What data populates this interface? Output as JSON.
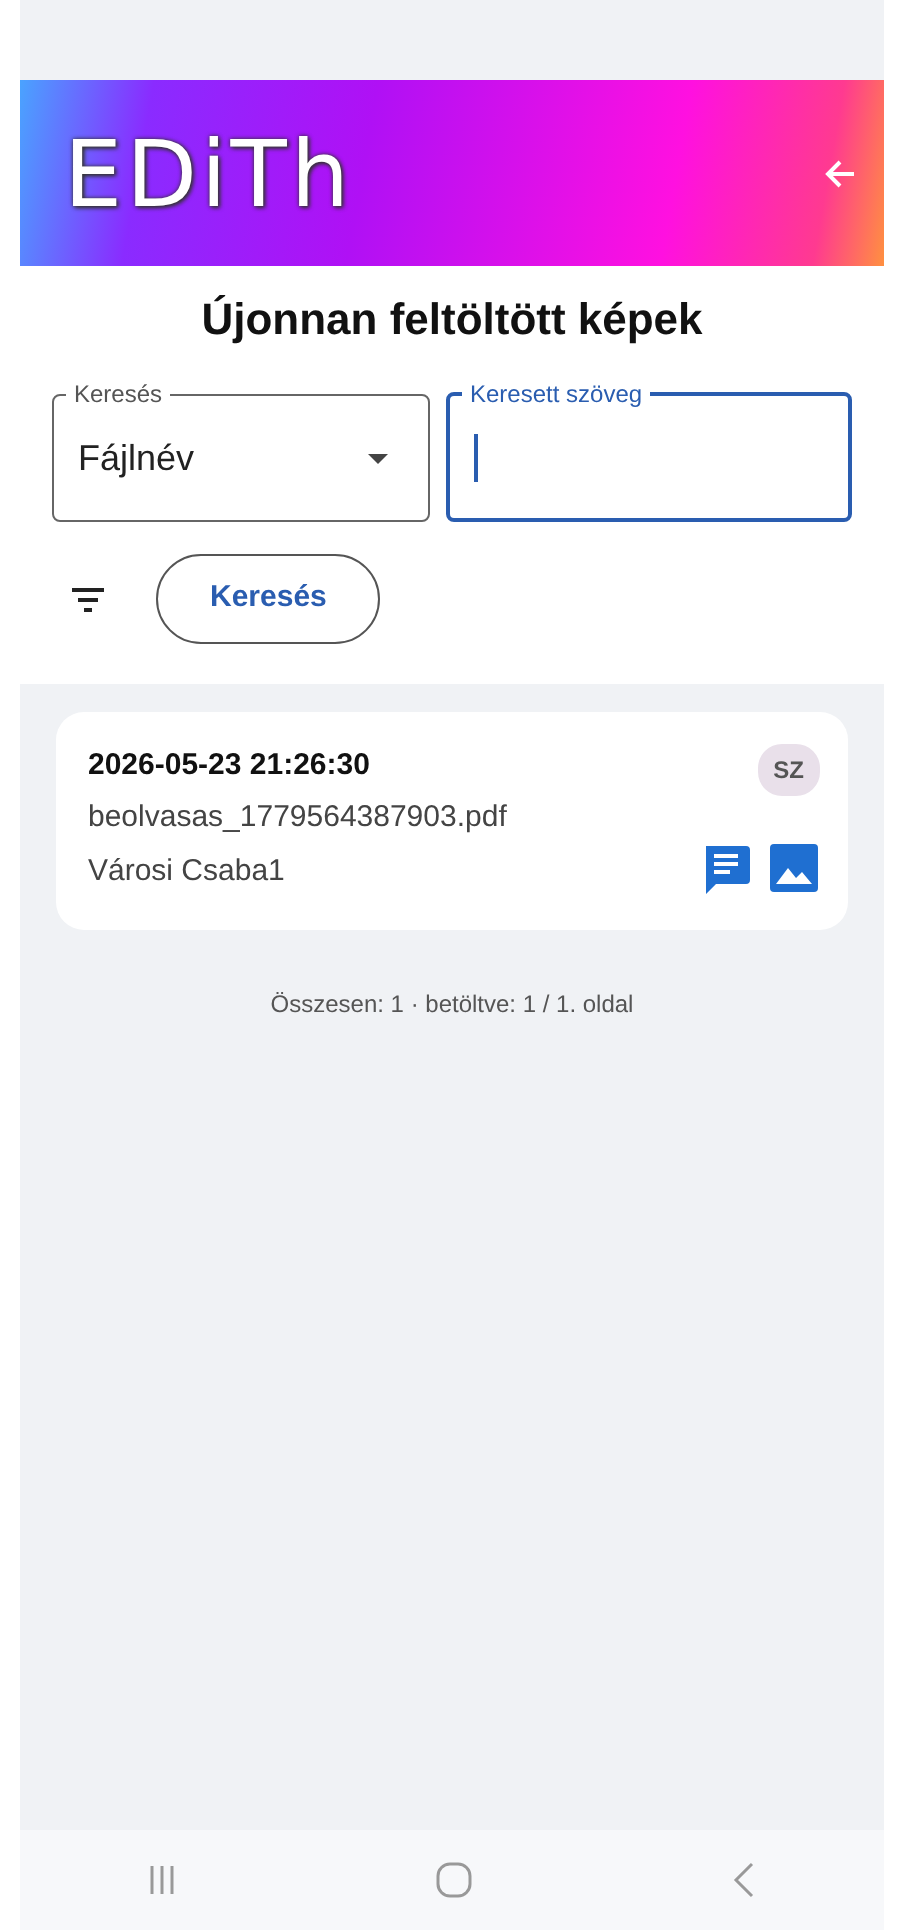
{
  "app_bar": {
    "logo": "EDiTh"
  },
  "title": "Újonnan feltöltött képek",
  "fields": [
    {
      "kind": "select",
      "label": "Keresés",
      "value": "Fájlnév",
      "focused": false
    },
    {
      "kind": "text",
      "label": "Keresett szöveg",
      "focused": true
    }
  ],
  "search_button": "Keresés",
  "items": [
    {
      "datetime": "2026-05-23 21:26:30",
      "file": "beolvasas_1779564387903.pdf",
      "user": "Városi Csaba1",
      "badge": "SZ"
    }
  ],
  "summary": "Összesen: 1 · betöltve: 1 / 1. oldal"
}
